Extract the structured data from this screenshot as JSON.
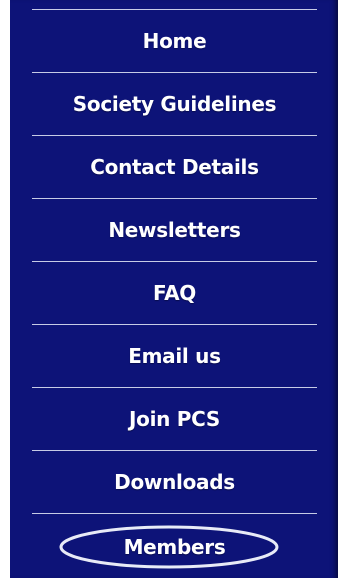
{
  "nav": {
    "items": [
      {
        "label": "Home"
      },
      {
        "label": "Society Guidelines"
      },
      {
        "label": "Contact Details"
      },
      {
        "label": "Newsletters"
      },
      {
        "label": "FAQ"
      },
      {
        "label": "Email us"
      },
      {
        "label": "Join PCS"
      },
      {
        "label": "Downloads"
      },
      {
        "label": "Members"
      }
    ]
  },
  "colors": {
    "background": "#0d1378",
    "divider": "#c6cbe6",
    "text": "#ffffff",
    "highlight_oval": "#e8ebf7"
  }
}
